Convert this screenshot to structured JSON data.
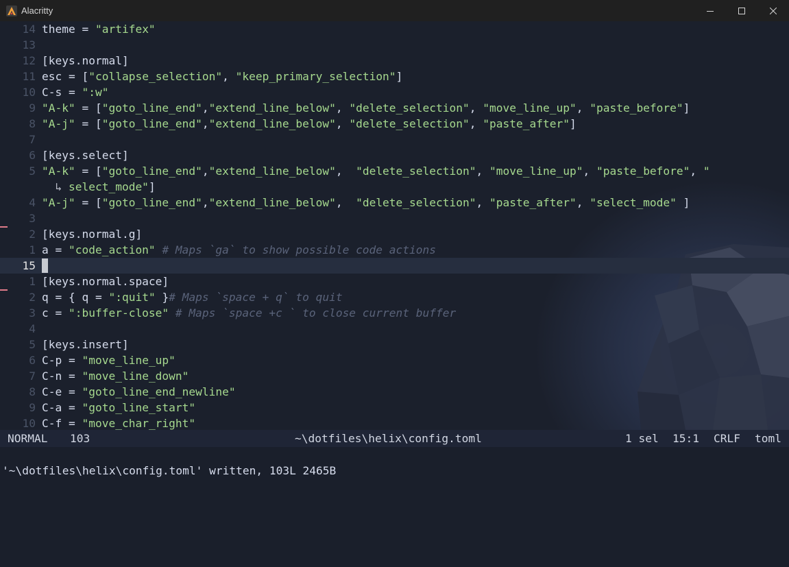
{
  "window": {
    "title": "Alacritty",
    "controls": [
      "minimize-icon",
      "maximize-icon",
      "close-icon"
    ]
  },
  "colors": {
    "background": "#1a1f2b",
    "text": "#d6dcec",
    "string": "#a6d98e",
    "comment": "#5a637a",
    "gutter": "#4a5366",
    "diff_marker": "#e07b8a",
    "current_line": "#262e3f"
  },
  "editor": {
    "lines": [
      {
        "num": "14",
        "segments": [
          {
            "t": "theme = "
          },
          {
            "t": "\"artifex\"",
            "k": "s"
          }
        ]
      },
      {
        "num": "13",
        "segments": []
      },
      {
        "num": "12",
        "segments": [
          {
            "t": "[keys.normal]"
          }
        ]
      },
      {
        "num": "11",
        "segments": [
          {
            "t": "esc = ["
          },
          {
            "t": "\"collapse_selection\"",
            "k": "s"
          },
          {
            "t": ", "
          },
          {
            "t": "\"keep_primary_selection\"",
            "k": "s"
          },
          {
            "t": "]"
          }
        ]
      },
      {
        "num": "10",
        "segments": [
          {
            "t": "C-s = "
          },
          {
            "t": "\":w\"",
            "k": "s"
          }
        ]
      },
      {
        "num": "9",
        "segments": [
          {
            "t": "\"A-k\"",
            "k": "s"
          },
          {
            "t": " = ["
          },
          {
            "t": "\"goto_line_end\"",
            "k": "s"
          },
          {
            "t": ","
          },
          {
            "t": "\"extend_line_below\"",
            "k": "s"
          },
          {
            "t": ", "
          },
          {
            "t": "\"delete_selection\"",
            "k": "s"
          },
          {
            "t": ", "
          },
          {
            "t": "\"move_line_up\"",
            "k": "s"
          },
          {
            "t": ", "
          },
          {
            "t": "\"paste_before\"",
            "k": "s"
          },
          {
            "t": "]"
          }
        ]
      },
      {
        "num": "8",
        "segments": [
          {
            "t": "\"A-j\"",
            "k": "s"
          },
          {
            "t": " = ["
          },
          {
            "t": "\"goto_line_end\"",
            "k": "s"
          },
          {
            "t": ","
          },
          {
            "t": "\"extend_line_below\"",
            "k": "s"
          },
          {
            "t": ", "
          },
          {
            "t": "\"delete_selection\"",
            "k": "s"
          },
          {
            "t": ", "
          },
          {
            "t": "\"paste_after\"",
            "k": "s"
          },
          {
            "t": "]"
          }
        ]
      },
      {
        "num": "7",
        "segments": []
      },
      {
        "num": "6",
        "segments": [
          {
            "t": "[keys.select]"
          }
        ]
      },
      {
        "num": "5",
        "segments": [
          {
            "t": "\"A-k\"",
            "k": "s"
          },
          {
            "t": " = ["
          },
          {
            "t": "\"goto_line_end\"",
            "k": "s"
          },
          {
            "t": ","
          },
          {
            "t": "\"extend_line_below\"",
            "k": "s"
          },
          {
            "t": ",  "
          },
          {
            "t": "\"delete_selection\"",
            "k": "s"
          },
          {
            "t": ", "
          },
          {
            "t": "\"move_line_up\"",
            "k": "s"
          },
          {
            "t": ", "
          },
          {
            "t": "\"paste_before\"",
            "k": "s"
          },
          {
            "t": ", "
          },
          {
            "t": "\"",
            "k": "s"
          }
        ]
      },
      {
        "num": "",
        "segments": [
          {
            "t": "  ↳ ",
            "k": "w"
          },
          {
            "t": "select_mode\"",
            "k": "s"
          },
          {
            "t": "]"
          }
        ]
      },
      {
        "num": "4",
        "segments": [
          {
            "t": "\"A-j\"",
            "k": "s"
          },
          {
            "t": " = ["
          },
          {
            "t": "\"goto_line_end\"",
            "k": "s"
          },
          {
            "t": ","
          },
          {
            "t": "\"extend_line_below\"",
            "k": "s"
          },
          {
            "t": ",  "
          },
          {
            "t": "\"delete_selection\"",
            "k": "s"
          },
          {
            "t": ", "
          },
          {
            "t": "\"paste_after\"",
            "k": "s"
          },
          {
            "t": ", "
          },
          {
            "t": "\"select_mode\"",
            "k": "s"
          },
          {
            "t": " ]"
          }
        ]
      },
      {
        "num": "3",
        "segments": []
      },
      {
        "num": "2",
        "segments": [
          {
            "t": "[keys.normal.g]"
          }
        ]
      },
      {
        "num": "1",
        "segments": [
          {
            "t": "a = "
          },
          {
            "t": "\"code_action\"",
            "k": "s"
          },
          {
            "t": " "
          },
          {
            "t": "# Maps `ga` to show possible code actions",
            "k": "c"
          }
        ]
      },
      {
        "num": "15",
        "current": true,
        "segments": []
      },
      {
        "num": "1",
        "segments": [
          {
            "t": "[keys.normal.space]"
          }
        ]
      },
      {
        "num": "2",
        "segments": [
          {
            "t": "q = { q = "
          },
          {
            "t": "\":quit\"",
            "k": "s"
          },
          {
            "t": " }"
          },
          {
            "t": "# Maps `space + q` to quit",
            "k": "c"
          }
        ]
      },
      {
        "num": "3",
        "segments": [
          {
            "t": "c = "
          },
          {
            "t": "\":buffer-close\"",
            "k": "s"
          },
          {
            "t": " "
          },
          {
            "t": "# Maps `space +c ` to close current buffer",
            "k": "c"
          }
        ]
      },
      {
        "num": "4",
        "segments": []
      },
      {
        "num": "5",
        "segments": [
          {
            "t": "[keys.insert]"
          }
        ]
      },
      {
        "num": "6",
        "segments": [
          {
            "t": "C-p = "
          },
          {
            "t": "\"move_line_up\"",
            "k": "s"
          }
        ]
      },
      {
        "num": "7",
        "segments": [
          {
            "t": "C-n = "
          },
          {
            "t": "\"move_line_down\"",
            "k": "s"
          }
        ]
      },
      {
        "num": "8",
        "segments": [
          {
            "t": "C-e = "
          },
          {
            "t": "\"goto_line_end_newline\"",
            "k": "s"
          }
        ]
      },
      {
        "num": "9",
        "segments": [
          {
            "t": "C-a = "
          },
          {
            "t": "\"goto_line_start\"",
            "k": "s"
          }
        ]
      },
      {
        "num": "10",
        "segments": [
          {
            "t": "C-f = "
          },
          {
            "t": "\"move_char_right\"",
            "k": "s"
          }
        ]
      }
    ]
  },
  "statusline": {
    "mode": "NORMAL",
    "line_count": "103",
    "file": "~\\dotfiles\\helix\\config.toml",
    "selections": "1 sel",
    "position": "15:1",
    "line_ending": "CRLF",
    "language": "toml"
  },
  "message": "'~\\dotfiles\\helix\\config.toml' written, 103L 2465B"
}
